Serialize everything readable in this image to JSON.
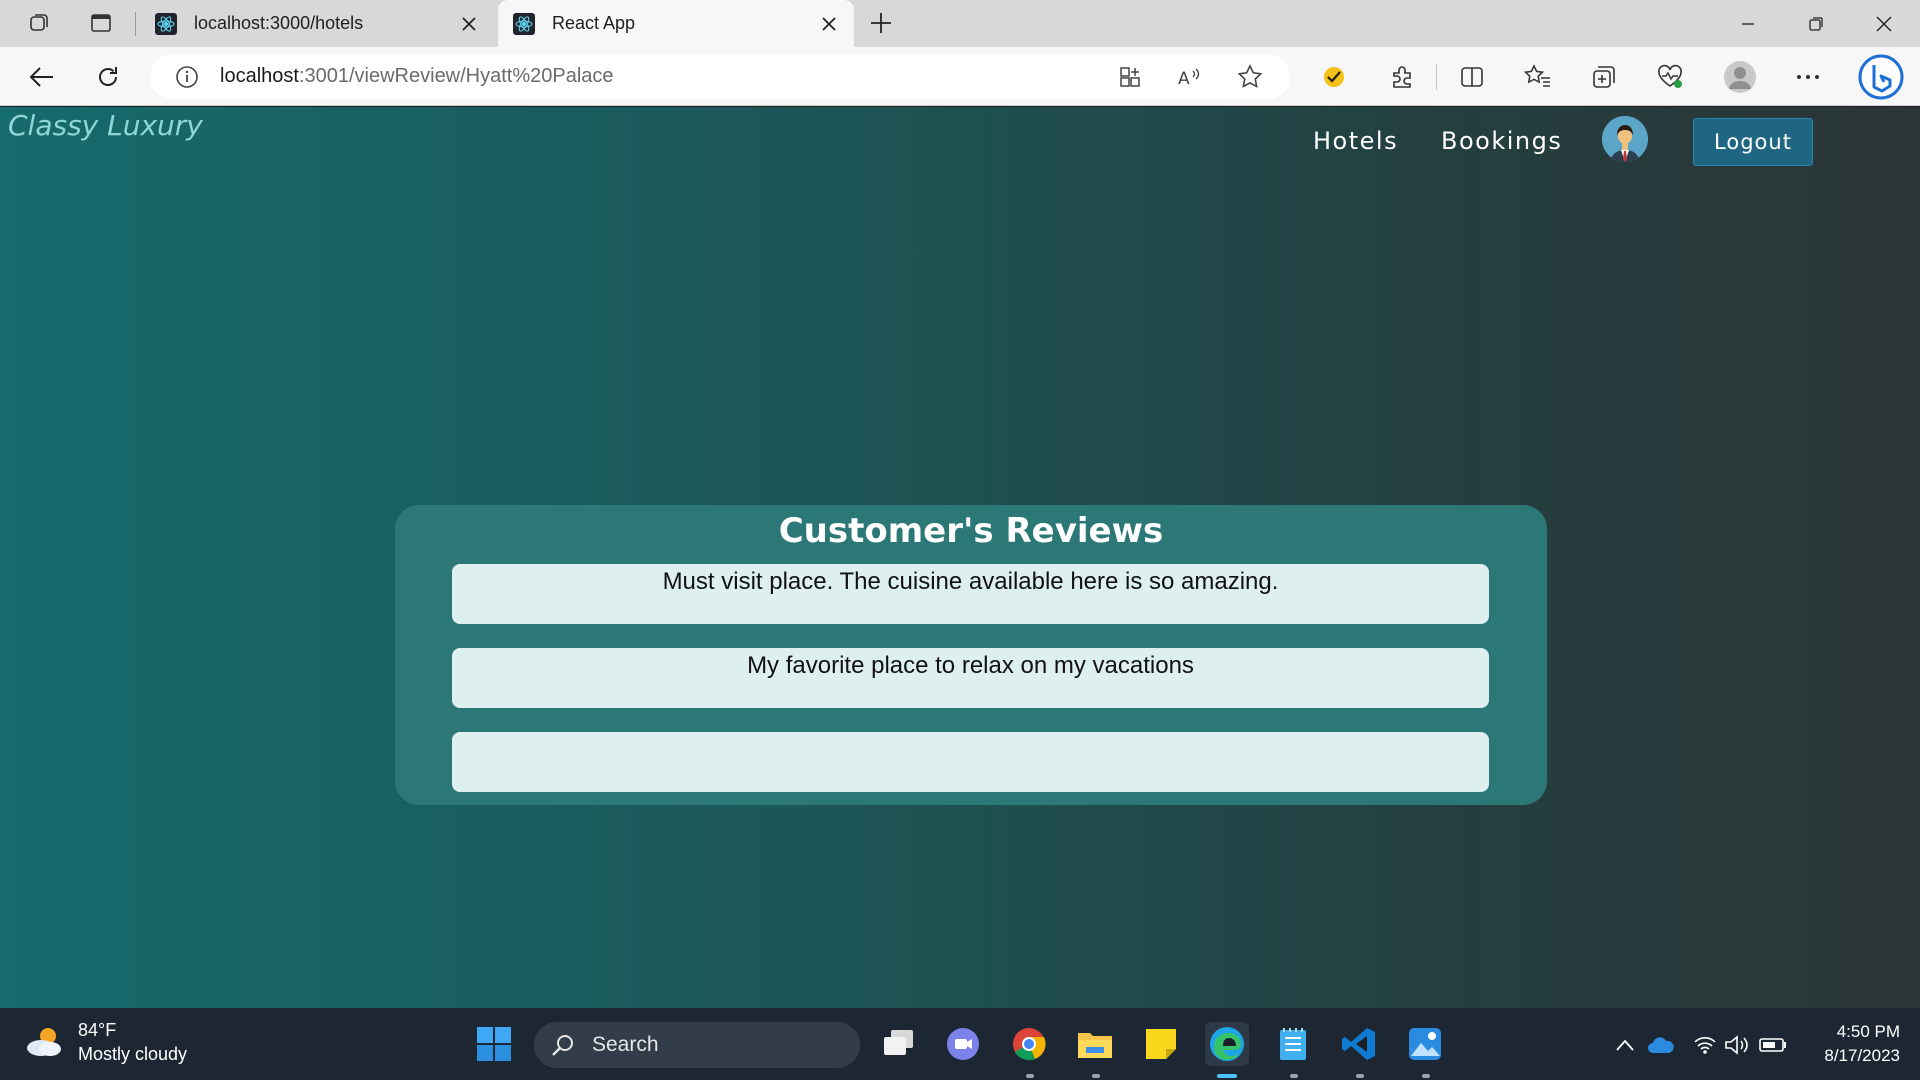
{
  "browser": {
    "tabs": [
      {
        "title": "localhost:3000/hotels",
        "active": false
      },
      {
        "title": "React App",
        "active": true
      }
    ],
    "address": {
      "host": "localhost",
      "rest": ":3001/viewReview/Hyatt%20Palace"
    },
    "toolbar_icons": [
      "extensions-icon",
      "split-screen-icon",
      "favorites-icon",
      "collections-icon",
      "browser-essentials-icon",
      "profile-icon",
      "more-icon",
      "bing-copilot-icon"
    ]
  },
  "site": {
    "brand": "Classy Luxury",
    "nav": {
      "hotels": "Hotels",
      "bookings": "Bookings"
    },
    "logout_label": "Logout"
  },
  "reviews": {
    "title": "Customer's Reviews",
    "items": [
      "Must visit place. The cuisine available here is so amazing.",
      "My favorite place to relax on my vacations",
      ""
    ]
  },
  "taskbar": {
    "weather": {
      "temp": "84°F",
      "condition": "Mostly cloudy"
    },
    "search_label": "Search",
    "clock": {
      "time": "4:50 PM",
      "date": "8/17/2023"
    }
  },
  "colors": {
    "page_gradient_start": "#166b6d",
    "page_gradient_end": "#2b3535",
    "card": "#2c7877",
    "review_box": "#ddefee",
    "logout_button": "#1f6682",
    "brand": "#8ed6d8"
  }
}
